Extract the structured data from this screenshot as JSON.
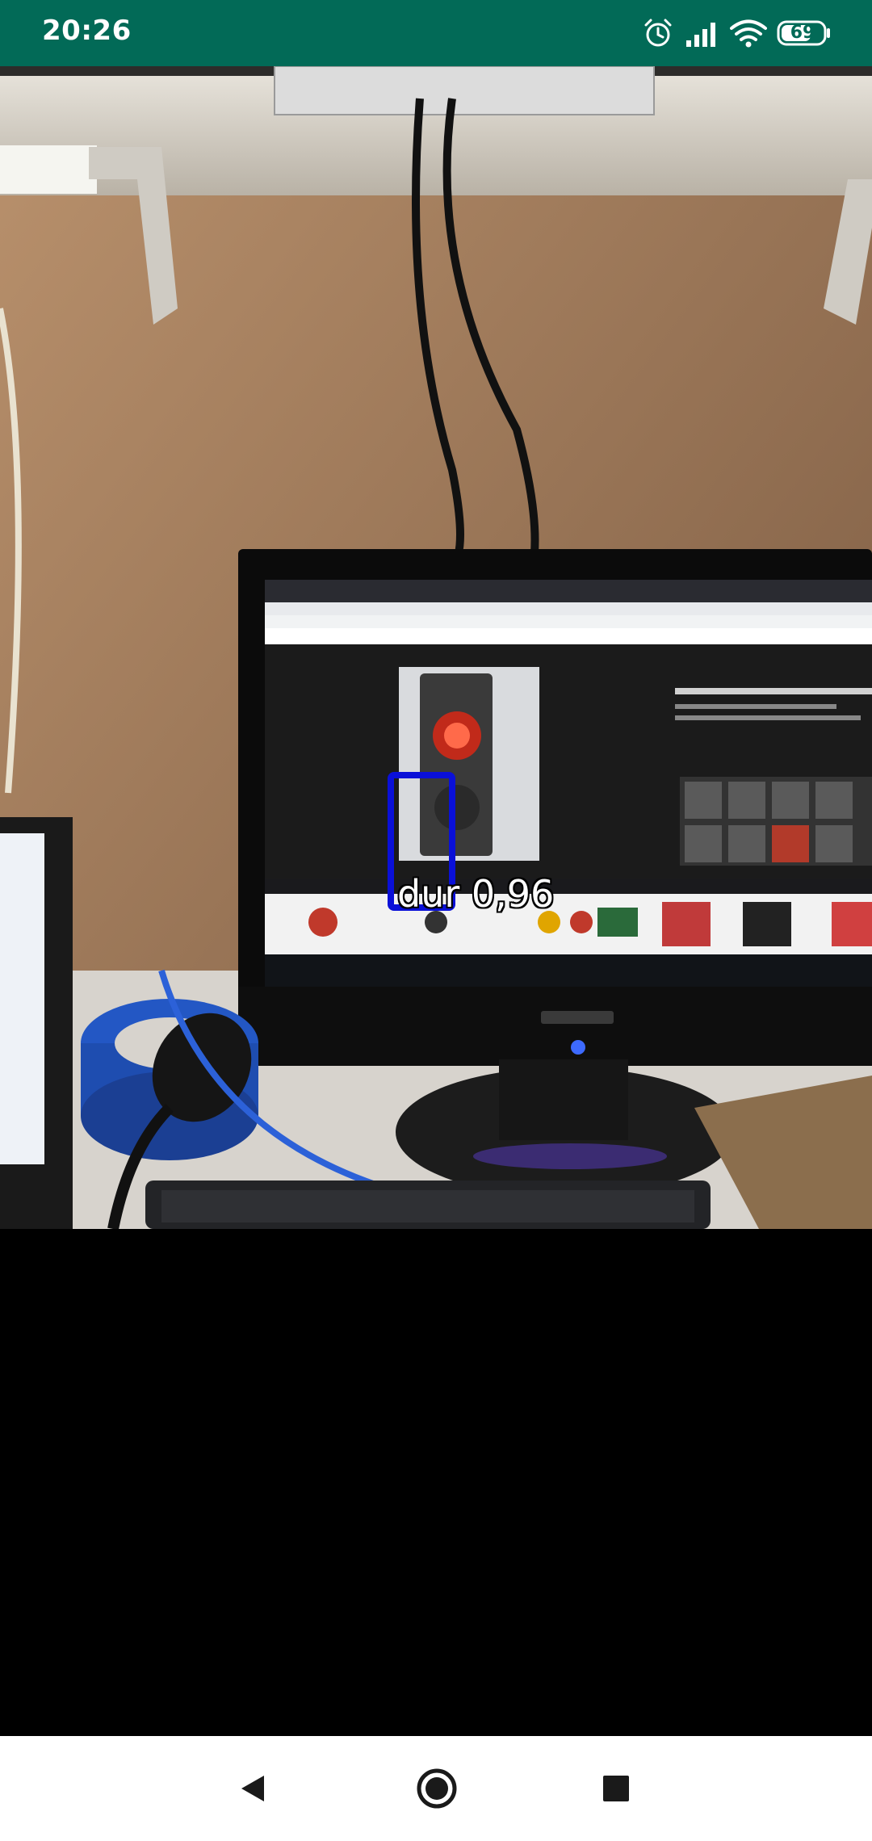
{
  "status_bar": {
    "time": "20:26",
    "battery_level": "69",
    "background_color": "#026a57",
    "icons": [
      "alarm-icon",
      "signal-icon",
      "wifi-icon",
      "battery-icon"
    ]
  },
  "detection": {
    "label": "dur 0,96",
    "box_color": "#0a10d8"
  },
  "navigation": {
    "icons": [
      "back-icon",
      "home-icon",
      "recents-icon"
    ]
  }
}
